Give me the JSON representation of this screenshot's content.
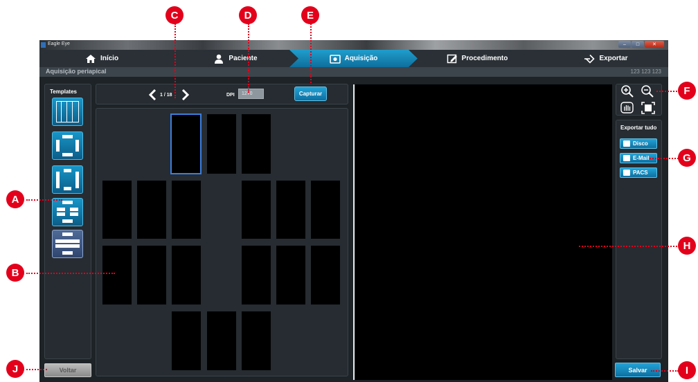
{
  "window": {
    "title": "Eagle Eye"
  },
  "nav": {
    "tabs": [
      {
        "label": "Início",
        "icon": "home-icon"
      },
      {
        "label": "Paciente",
        "icon": "person-icon"
      },
      {
        "label": "Aquisição",
        "icon": "camera-icon",
        "active": true
      },
      {
        "label": "Procedimento",
        "icon": "edit-icon"
      },
      {
        "label": "Exportar",
        "icon": "export-arrow-icon"
      }
    ]
  },
  "subheader": {
    "title": "Aquisição periapical",
    "patient_id": "123 123 123"
  },
  "templates": {
    "title": "Templates"
  },
  "toolbar": {
    "page": "1 / 18",
    "dpi_label": "DPI",
    "dpi_value": "1270",
    "capture_label": "Capturar"
  },
  "tools": [
    "zoom-in-icon",
    "zoom-out-icon",
    "pan-hand-icon",
    "fit-screen-icon"
  ],
  "export": {
    "title": "Exportar tudo",
    "buttons": [
      {
        "label": "Disco",
        "icon": "disk-icon"
      },
      {
        "label": "E-Mail",
        "icon": "email-icon"
      },
      {
        "label": "PACS",
        "icon": "pacs-icon"
      }
    ]
  },
  "actions": {
    "back_label": "Voltar",
    "save_label": "Salvar"
  },
  "callouts": [
    "A",
    "B",
    "C",
    "D",
    "E",
    "F",
    "G",
    "H",
    "I",
    "J"
  ],
  "colors": {
    "accent": "#1a8fc4",
    "callout": "#e3001b",
    "background": "#1d2327",
    "selection": "#3b7ee0"
  }
}
